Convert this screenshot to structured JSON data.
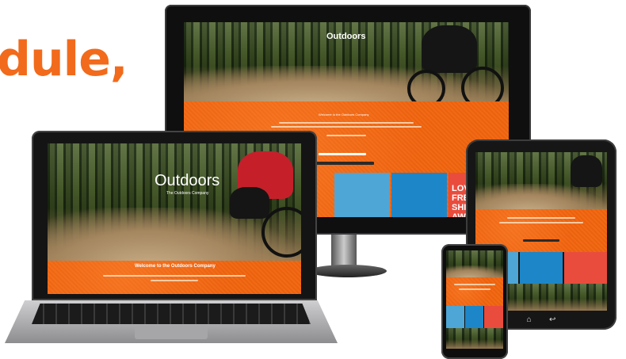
{
  "headline": "dule,",
  "site": {
    "logo_name": "Outdoors",
    "logo_tagline": "The Outdoors Company",
    "welcome": "Welcome to the Outdoors Company",
    "tile_text": "LOVE IS FREE SHIPPING AWAY"
  },
  "colors": {
    "accent": "#f26a1b",
    "orange_band": "#f2640e"
  },
  "icons": [
    "power-icon",
    "home-icon",
    "back-icon"
  ]
}
